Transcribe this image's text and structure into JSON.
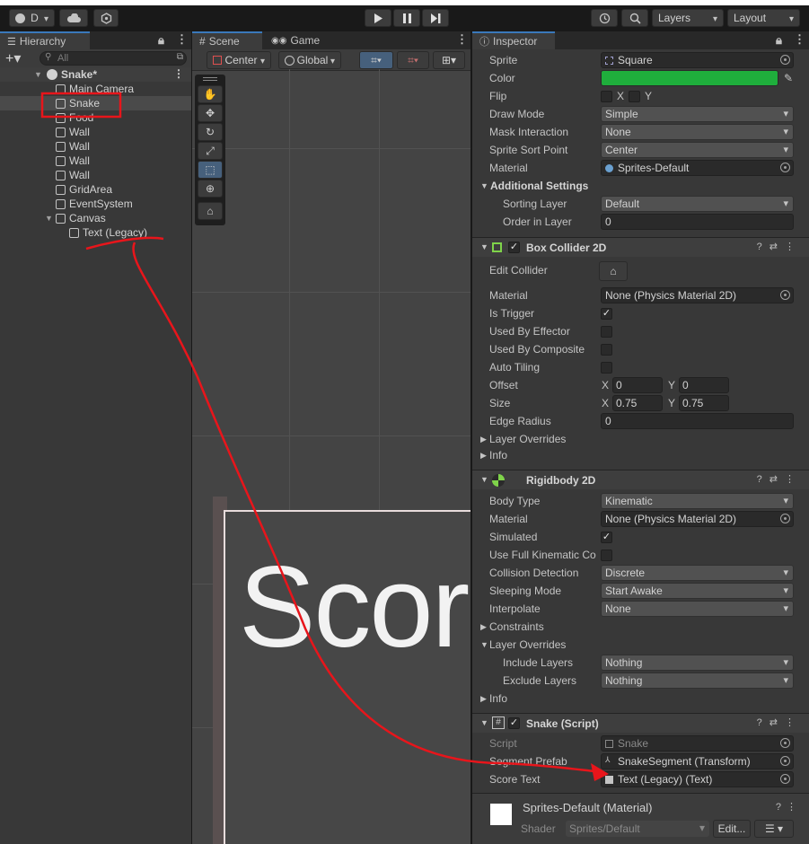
{
  "toolbar": {
    "account_label": "D",
    "layers_label": "Layers",
    "layout_label": "Layout"
  },
  "hierarchy": {
    "tab_label": "Hierarchy",
    "search_placeholder": "All",
    "scene_name": "Snake*",
    "items": [
      {
        "label": "Main Camera"
      },
      {
        "label": "Snake"
      },
      {
        "label": "Food"
      },
      {
        "label": "Wall"
      },
      {
        "label": "Wall"
      },
      {
        "label": "Wall"
      },
      {
        "label": "Wall"
      },
      {
        "label": "GridArea"
      },
      {
        "label": "EventSystem"
      },
      {
        "label": "Canvas"
      },
      {
        "label": "Text (Legacy)"
      }
    ]
  },
  "scene": {
    "tab_scene": "Scene",
    "tab_game": "Game",
    "pivot_label": "Center",
    "space_label": "Global",
    "canvas_text": "Scor"
  },
  "inspector": {
    "tab_label": "Inspector",
    "sprite_renderer": {
      "sprite_label": "Sprite",
      "sprite_value": "Square",
      "color_label": "Color",
      "color_value": "#1fae3c",
      "flip_label": "Flip",
      "flip_x": "X",
      "flip_y": "Y",
      "draw_mode_label": "Draw Mode",
      "draw_mode_value": "Simple",
      "mask_label": "Mask Interaction",
      "mask_value": "None",
      "sort_point_label": "Sprite Sort Point",
      "sort_point_value": "Center",
      "material_label": "Material",
      "material_value": "Sprites-Default",
      "additional_label": "Additional Settings",
      "sorting_layer_label": "Sorting Layer",
      "sorting_layer_value": "Default",
      "order_label": "Order in Layer",
      "order_value": "0"
    },
    "box_collider": {
      "title": "Box Collider 2D",
      "edit_label": "Edit Collider",
      "material_label": "Material",
      "material_value": "None (Physics Material 2D)",
      "trigger_label": "Is Trigger",
      "effector_label": "Used By Effector",
      "composite_label": "Used By Composite",
      "tiling_label": "Auto Tiling",
      "offset_label": "Offset",
      "offset_x": "0",
      "offset_y": "0",
      "size_label": "Size",
      "size_x": "0.75",
      "size_y": "0.75",
      "edge_label": "Edge Radius",
      "edge_value": "0",
      "overrides_label": "Layer Overrides",
      "info_label": "Info",
      "x_axis": "X",
      "y_axis": "Y"
    },
    "rigidbody": {
      "title": "Rigidbody 2D",
      "body_type_label": "Body Type",
      "body_type_value": "Kinematic",
      "material_label": "Material",
      "material_value": "None (Physics Material 2D)",
      "simulated_label": "Simulated",
      "kinematic_label": "Use Full Kinematic Co",
      "collision_label": "Collision Detection",
      "collision_value": "Discrete",
      "sleeping_label": "Sleeping Mode",
      "sleeping_value": "Start Awake",
      "interpolate_label": "Interpolate",
      "interpolate_value": "None",
      "constraints_label": "Constraints",
      "overrides_label": "Layer Overrides",
      "include_label": "Include Layers",
      "include_value": "Nothing",
      "exclude_label": "Exclude Layers",
      "exclude_value": "Nothing",
      "info_label": "Info"
    },
    "snake_script": {
      "title": "Snake (Script)",
      "script_label": "Script",
      "script_value": "Snake",
      "prefab_label": "Segment Prefab",
      "prefab_value": "SnakeSegment (Transform)",
      "score_label": "Score Text",
      "score_value": "Text (Legacy) (Text)"
    },
    "material_footer": {
      "title": "Sprites-Default (Material)",
      "shader_label": "Shader",
      "shader_value": "Sprites/Default",
      "edit_label": "Edit..."
    }
  },
  "annotation_color": "#e8151b"
}
